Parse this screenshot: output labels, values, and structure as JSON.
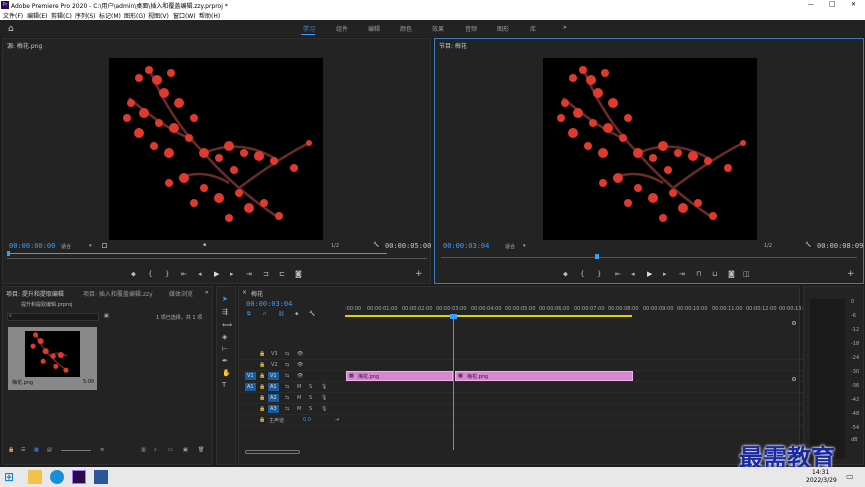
{
  "title": "Adobe Premiere Pro 2020 - C:\\用户\\admin\\桌面\\插入和覆盖编辑.zzy.prproj *",
  "window_controls": {
    "min": "—",
    "max": "□",
    "close": "✕"
  },
  "menu": [
    "文件(F)",
    "编辑(E)",
    "剪辑(C)",
    "序列(S)",
    "标记(M)",
    "图形(G)",
    "视图(V)",
    "窗口(W)",
    "帮助(H)"
  ],
  "workspaces": [
    "学习",
    "组件",
    "编辑",
    "颜色",
    "效果",
    "音频",
    "图形",
    "库"
  ],
  "workspace_more": "»",
  "source": {
    "title": "源: 梅花.png",
    "timecode_in": "00:00:00:00",
    "fit": "适合",
    "fraction": "1/2",
    "duration": "00:00:05:00"
  },
  "program": {
    "title": "节目: 梅花",
    "timecode": "00:00:03:04",
    "fit": "适合",
    "fraction": "1/2",
    "duration": "00:00:08:09"
  },
  "project": {
    "tab1": "项目: 提升和提取编辑",
    "tab2": "项目: 插入和覆盖编辑.zzy",
    "tab3": "媒体浏览",
    "more": "»",
    "file": "提升和提取编辑.prproj",
    "selection": "1 项已选择，共 1 项",
    "item_name": "梅花.png",
    "item_duration": "5:00"
  },
  "timeline": {
    "tab": "梅花",
    "timecode": "00:00:03:04",
    "ruler": [
      ":00:00",
      "00:00:01:00",
      "00:00:02:00",
      "00:00:03:00",
      "00:00:04:00",
      "00:00:05:00",
      "00:00:06:00",
      "00:00:07:00",
      "00:00:08:00",
      "00:00:09:00",
      "00:00:10:00",
      "00:00:11:00",
      "00:00:12:00",
      "00:00:13:00"
    ],
    "tracks": [
      {
        "name": "V3"
      },
      {
        "name": "V2"
      },
      {
        "name": "V1",
        "src": "V1"
      },
      {
        "name": "A1",
        "src": "A1",
        "m": "M",
        "s": "S"
      },
      {
        "name": "A2",
        "m": "M",
        "s": "S"
      },
      {
        "name": "A3",
        "m": "M",
        "s": "S"
      }
    ],
    "master_label": "主声道",
    "master_value": "0.0",
    "clips": [
      {
        "label": "梅花.png"
      },
      {
        "label": "梅花.png"
      }
    ]
  },
  "meter_scale": [
    "0",
    "-6",
    "-12",
    "-18",
    "-24",
    "-30",
    "-36",
    "-42",
    "-48",
    "-54",
    "dB"
  ],
  "watermark": "最需教育",
  "taskbar": {
    "time": "14:31",
    "date": "2022/3/29"
  },
  "colors": {
    "accent": "#3a9cff",
    "clip": "#d787d0",
    "watermark": "#1a2aa0"
  }
}
